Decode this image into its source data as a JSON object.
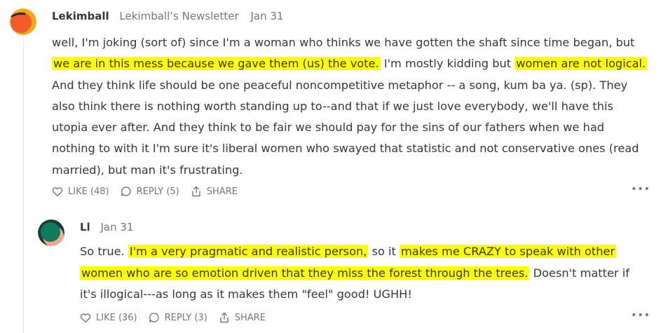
{
  "comments": [
    {
      "author": "Lekimball",
      "publication": "Lekimball’s Newsletter",
      "date": "Jan 31",
      "lines": [
        [
          {
            "t": "well, I'm joking (sort of) since I'm a woman who thinks we have gotten the shaft since time began, but",
            "h": false
          }
        ],
        [
          {
            "t": "we are in this mess because we gave them (us) the vote.",
            "h": true
          },
          {
            "t": " I'm mostly kidding but ",
            "h": false
          },
          {
            "t": "women are not logical.",
            "h": true
          }
        ],
        [
          {
            "t": "And they think life should be one peaceful noncompetitive metaphor -- a song, kum ba ya. (sp). They",
            "h": false
          }
        ],
        [
          {
            "t": "also think there is nothing worth standing up to--and that if we just love everybody, we'll have this",
            "h": false
          }
        ],
        [
          {
            "t": "utopia ever after. And they think to be fair we should pay for the sins of our fathers when we had",
            "h": false
          }
        ],
        [
          {
            "t": "nothing to with it I'm sure it's liberal women who swayed that statistic and not conservative ones (read",
            "h": false
          }
        ],
        [
          {
            "t": "married), but man it's frustrating.",
            "h": false
          }
        ]
      ],
      "like_label": "LIKE (48)",
      "reply_label": "REPLY (5)",
      "share_label": "SHARE",
      "more_label": "•••",
      "avatar_colors": [
        "#f25c2a",
        "#f4a91d",
        "#2e2e2e"
      ]
    },
    {
      "author": "Ll",
      "publication": "",
      "date": "Jan 31",
      "lines": [
        [
          {
            "t": "So true. ",
            "h": false
          },
          {
            "t": "I'm a very pragmatic and realistic person,",
            "h": true
          },
          {
            "t": " so it ",
            "h": false
          },
          {
            "t": "makes me CRAZY to speak with other",
            "h": true
          }
        ],
        [
          {
            "t": "women who are so emotion driven that they miss the forest through the trees.",
            "h": true
          },
          {
            "t": " Doesn't matter if",
            "h": false
          }
        ],
        [
          {
            "t": "it's illogical---as long as it makes them \"feel\" good! UGHH!",
            "h": false
          }
        ]
      ],
      "like_label": "LIKE (36)",
      "reply_label": "REPLY (3)",
      "share_label": "SHARE",
      "more_label": "•••",
      "avatar_colors": [
        "#0f7a5c",
        "#f2a98b",
        "#1f3a33"
      ]
    }
  ],
  "colors": {
    "highlight": "#ffff00",
    "text": "#363737",
    "muted": "#757575"
  },
  "icons": [
    "heart-icon",
    "comment-icon",
    "share-icon",
    "more-icon"
  ]
}
